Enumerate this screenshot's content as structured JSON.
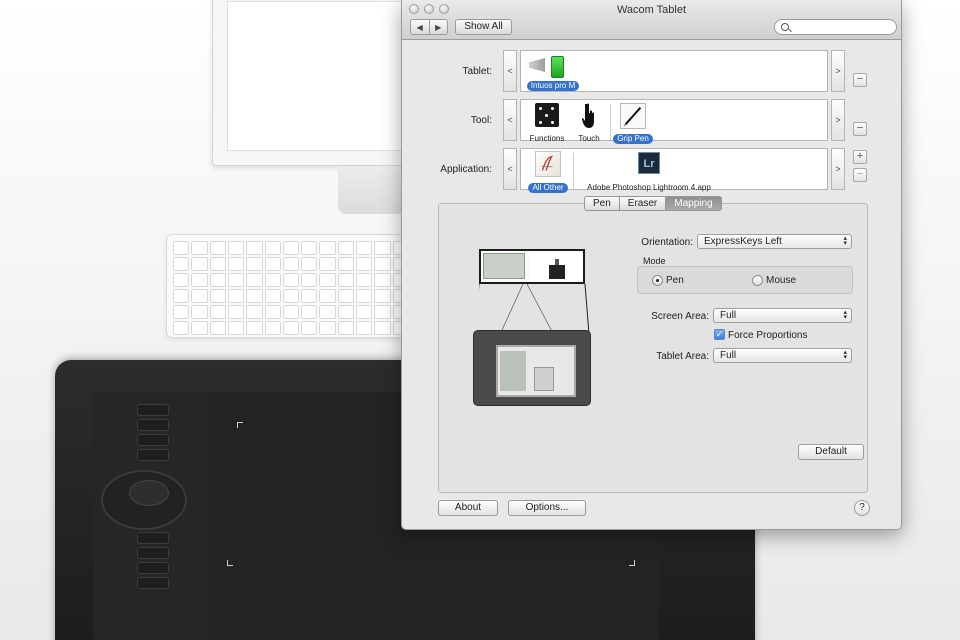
{
  "window": {
    "title": "Wacom Tablet"
  },
  "toolbar": {
    "back_glyph": "◀",
    "forward_glyph": "▶",
    "show_all": "Show All",
    "search_placeholder": ""
  },
  "tablet_row": {
    "label": "Tablet:",
    "items": [
      {
        "name": "Intuos pro M",
        "selected": true,
        "icon": "tablet-battery-icon"
      }
    ]
  },
  "tool_row": {
    "label": "Tool:",
    "items": [
      {
        "name": "Functions",
        "selected": false,
        "icon": "functions-icon"
      },
      {
        "name": "Touch",
        "selected": false,
        "icon": "touch-hand-icon"
      },
      {
        "name": "Grip Pen",
        "selected": true,
        "icon": "pen-icon"
      }
    ]
  },
  "application_row": {
    "label": "Application:",
    "items": [
      {
        "name": "All Other",
        "selected": true,
        "icon": "all-other-app-icon"
      },
      {
        "name": "Adobe Photoshop Lightroom 4.app",
        "selected": false,
        "icon": "lightroom-icon",
        "icon_text": "Lr"
      }
    ]
  },
  "row_controls": {
    "prev": "<",
    "next": ">",
    "remove": "−",
    "add": "+"
  },
  "tabs": [
    {
      "label": "Pen",
      "selected": false
    },
    {
      "label": "Eraser",
      "selected": false
    },
    {
      "label": "Mapping",
      "selected": true
    }
  ],
  "mapping": {
    "orientation": {
      "label": "Orientation:",
      "value": "ExpressKeys Left"
    },
    "mode": {
      "label": "Mode",
      "options": [
        {
          "label": "Pen",
          "selected": true
        },
        {
          "label": "Mouse",
          "selected": false
        }
      ]
    },
    "screen_area": {
      "label": "Screen Area:",
      "value": "Full"
    },
    "force_proportions": {
      "label": "Force Proportions",
      "checked": true
    },
    "tablet_area": {
      "label": "Tablet Area:",
      "value": "Full"
    },
    "default_button": "Default"
  },
  "footer": {
    "about": "About",
    "options": "Options...",
    "help": "?"
  },
  "colors": {
    "selection_blue": "#3472cc",
    "window_bg": "#e8e8e8",
    "battery_green": "#2fbf2f"
  }
}
